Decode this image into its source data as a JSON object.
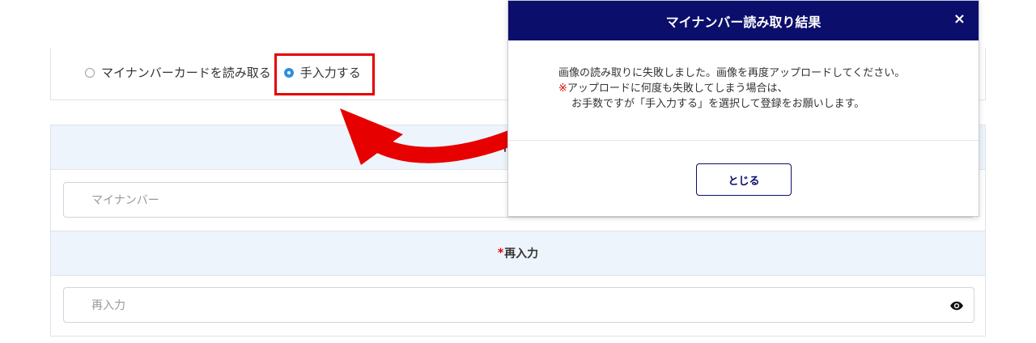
{
  "selection": {
    "option_card": "マイナンバーカードを読み取る",
    "option_manual": "手入力する",
    "selected": "manual"
  },
  "form": {
    "field1_label": "マイナンバー",
    "required_mark": "*",
    "field1_placeholder": "マイナンバー",
    "field2_label": "再入力",
    "field2_placeholder": "再入力"
  },
  "modal": {
    "title": "マイナンバー読み取り結果",
    "close": "×",
    "line1": "画像の読み取りに失敗しました。画像を再度アップロードしてください。",
    "note_mark": "※",
    "line2": "アップロードに何度も失敗してしまう場合は、",
    "line3": "お手数ですが「手入力する」を選択して登録をお願いします。",
    "button": "とじる"
  },
  "colors": {
    "modal_header": "#0b0e6b",
    "highlight": "#e60000",
    "radio_selected": "#2f8fe0",
    "section_bg": "#edf4fb"
  },
  "icons": {
    "show_password": "eye-icon"
  }
}
